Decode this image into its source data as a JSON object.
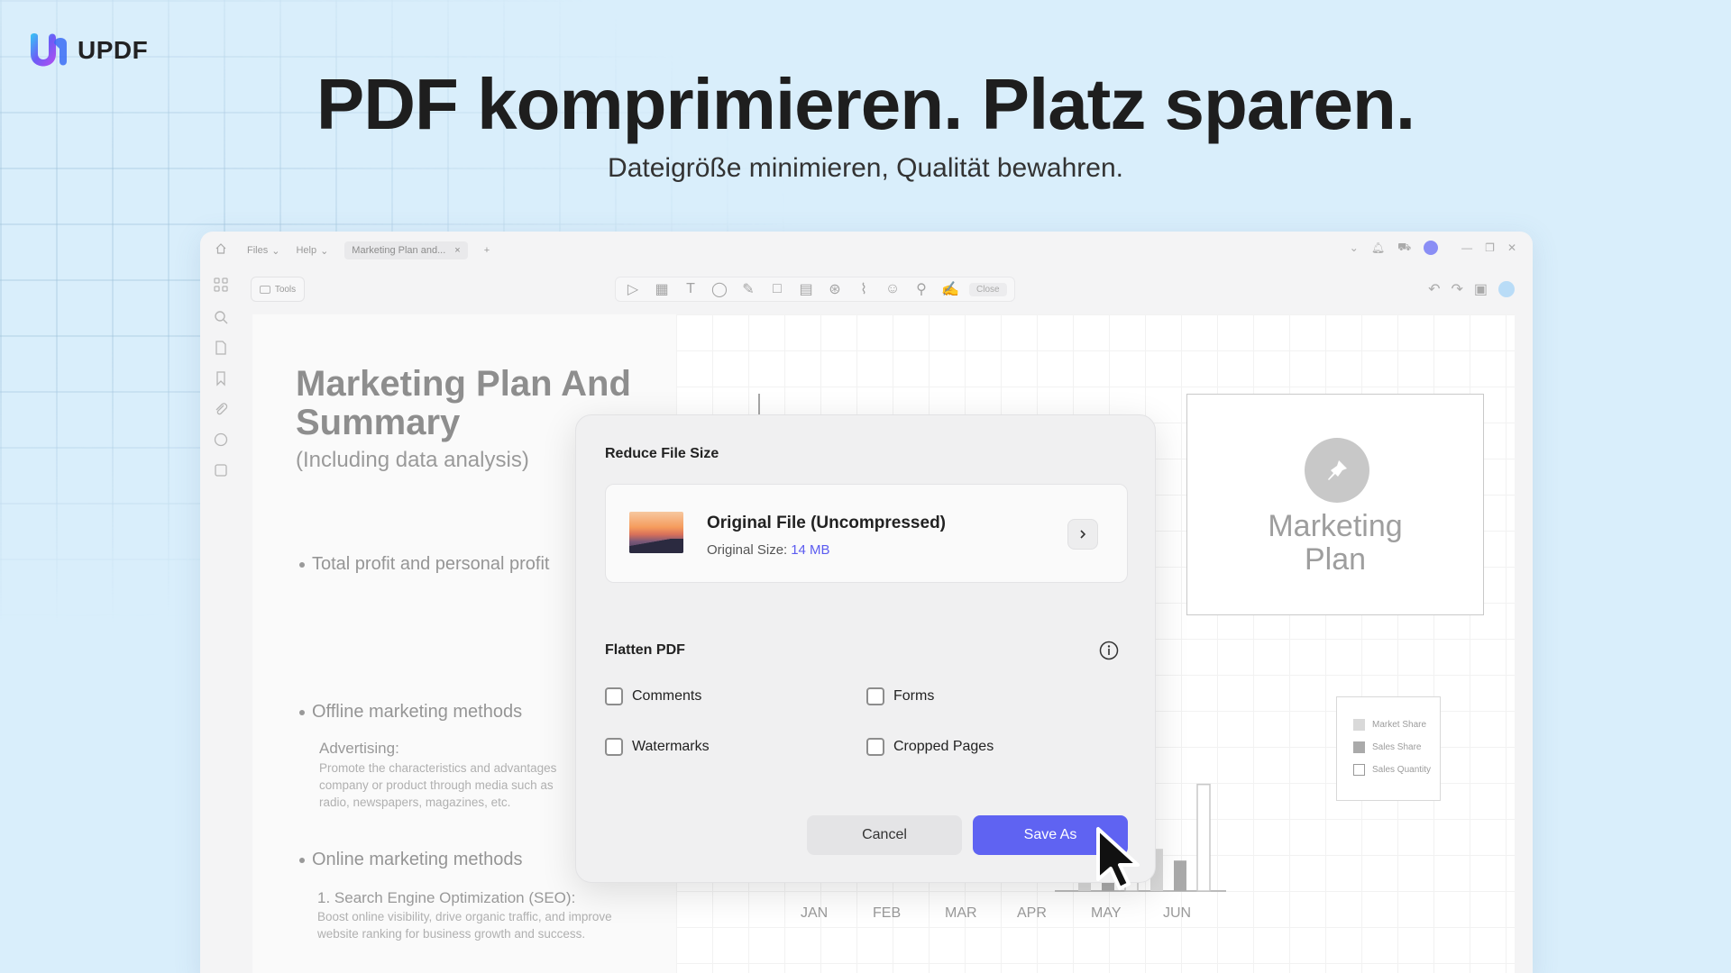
{
  "brand": {
    "name": "UPDF"
  },
  "hero": {
    "title": "PDF komprimieren. Platz sparen.",
    "subtitle": "Dateigröße minimieren, Qualität bewahren."
  },
  "app": {
    "menu": {
      "files": "Files",
      "help": "Help"
    },
    "tab": {
      "label": "Marketing Plan and..."
    },
    "toolbar": {
      "tools_label": "Tools",
      "close_label": "Close"
    }
  },
  "document": {
    "title": "Marketing Plan And Summary",
    "subtitle": "(Including data analysis)",
    "bullets": {
      "b1": "Total profit and personal profit",
      "b2": "Offline marketing methods",
      "b3": "Online marketing methods"
    },
    "advertising": {
      "heading": "Advertising:",
      "line1": "Promote the characteristics and advantages",
      "line2": "company or product through media such as",
      "line3": "radio, newspapers, magazines, etc."
    },
    "seo": {
      "heading": "1. Search Engine Optimization (SEO):",
      "line1": "Boost online visibility, drive organic traffic, and improve",
      "line2": "website ranking for business growth and success."
    },
    "card": {
      "line1": "Marketing",
      "line2": "Plan"
    },
    "legend": {
      "market_share": "Market Share",
      "sales_share": "Sales Share",
      "sales_quantity": "Sales Quantity"
    }
  },
  "chart_data": {
    "type": "bar",
    "categories": [
      "JAN",
      "FEB",
      "MAR",
      "APR",
      "MAY",
      "JUN"
    ],
    "series": [
      {
        "name": "Market Share",
        "values": [
          null,
          null,
          null,
          null,
          0.8,
          0.36
        ],
        "color": "#d9d9d9"
      },
      {
        "name": "Sales Share",
        "values": [
          null,
          null,
          null,
          null,
          0.8,
          0.26
        ],
        "color": "#aaaaaa"
      },
      {
        "name": "Sales Quantity",
        "values": [
          null,
          null,
          null,
          null,
          0.91,
          0.91
        ],
        "color": "#ffffff"
      }
    ],
    "grid": true,
    "legend": "right"
  },
  "modal": {
    "title": "Reduce File Size",
    "file": {
      "name": "Original File (Uncompressed)",
      "size_label": "Original Size:",
      "size_value": "14 MB"
    },
    "flatten": {
      "title": "Flatten PDF",
      "options": {
        "comments": "Comments",
        "forms": "Forms",
        "watermarks": "Watermarks",
        "cropped_pages": "Cropped Pages"
      }
    },
    "buttons": {
      "cancel": "Cancel",
      "save_as": "Save As"
    }
  },
  "colors": {
    "background": "#d9eefb",
    "accent": "#5f63f2",
    "size_value": "#5b5bf0"
  },
  "icons": [
    "updf-logo-icon",
    "home-icon",
    "grid-icon",
    "search-icon",
    "page-icon",
    "bookmark-icon",
    "paperclip-icon",
    "comment-icon",
    "stamp-icon",
    "info-icon",
    "chevron-right-icon",
    "cursor-icon",
    "pin-icon"
  ]
}
